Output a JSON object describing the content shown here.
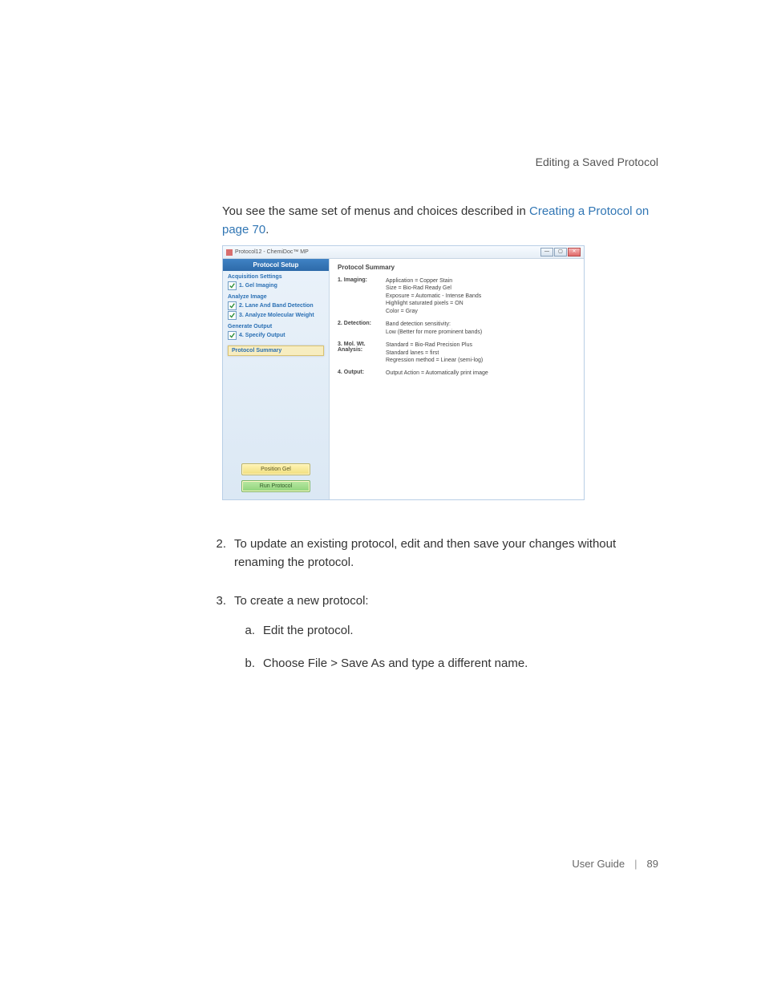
{
  "header": {
    "section": "Editing a Saved Protocol"
  },
  "intro": {
    "prefix": "You see the same set of menus and choices described in ",
    "link": "Creating a Protocol on page 70",
    "suffix": "."
  },
  "shot": {
    "title": "Protocol12 - ChemiDoc™ MP",
    "win": {
      "min": "—",
      "max": "▢",
      "close": "✕"
    },
    "sidebar": {
      "caption": "Protocol Setup",
      "groups": [
        {
          "label": "Acquisition Settings",
          "items": [
            {
              "text": "1. Gel Imaging"
            }
          ]
        },
        {
          "label": "Analyze Image",
          "items": [
            {
              "text": "2. Lane And Band Detection"
            },
            {
              "text": "3. Analyze Molecular Weight"
            }
          ]
        },
        {
          "label": "Generate Output",
          "items": [
            {
              "text": "4. Specify Output"
            }
          ]
        }
      ],
      "selected": "Protocol Summary",
      "btn_yellow": "Position Gel",
      "btn_green": "Run Protocol"
    },
    "main": {
      "title": "Protocol Summary",
      "rows": [
        {
          "k": "1. Imaging:",
          "v": "Application = Copper Stain\nSize = Bio-Rad Ready Gel\nExposure = Automatic - Intense Bands\nHighlight saturated pixels = ON\nColor = Gray"
        },
        {
          "k": "2. Detection:",
          "v": "Band detection sensitivity:\nLow (Better for more prominent bands)"
        },
        {
          "k": "3. Mol. Wt. Analysis:",
          "v": "Standard = Bio-Rad Precision Plus\nStandard lanes = first\nRegression method = Linear (semi-log)"
        },
        {
          "k": "4. Output:",
          "v": "Output Action = Automatically print image"
        }
      ]
    }
  },
  "list": {
    "start": 2,
    "items": [
      {
        "text": "To update an existing protocol, edit and then save your changes without renaming the protocol."
      },
      {
        "text": "To create a new protocol:",
        "sub": [
          {
            "text": "Edit the protocol."
          },
          {
            "text": "Choose File > Save As and type a different name."
          }
        ]
      }
    ]
  },
  "footer": {
    "label": "User Guide",
    "page": "89"
  }
}
